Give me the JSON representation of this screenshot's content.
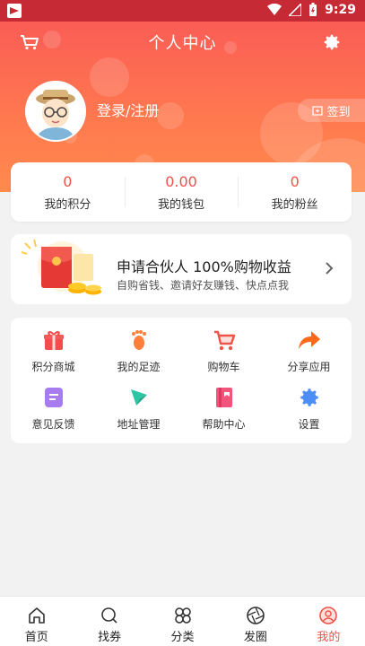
{
  "status_bar": {
    "time": "9:29"
  },
  "header": {
    "title": "个人中心"
  },
  "profile": {
    "login_label": "登录/注册",
    "checkin_label": "签到"
  },
  "stats": [
    {
      "value": "0",
      "label": "我的积分"
    },
    {
      "value": "0.00",
      "label": "我的钱包"
    },
    {
      "value": "0",
      "label": "我的粉丝"
    }
  ],
  "promo": {
    "title": "申请合伙人 100%购物收益",
    "subtitle": "自购省钱、邀请好友赚钱、快点点我"
  },
  "menu": [
    {
      "label": "积分商城",
      "icon": "gift-icon",
      "color": "#f44b4b"
    },
    {
      "label": "我的足迹",
      "icon": "footprint-icon",
      "color": "#ff7e3a"
    },
    {
      "label": "购物车",
      "icon": "cart-icon",
      "color": "#f0534a"
    },
    {
      "label": "分享应用",
      "icon": "share-icon",
      "color": "#ff6a1a"
    },
    {
      "label": "意见反馈",
      "icon": "feedback-icon",
      "color": "#a77cf0"
    },
    {
      "label": "地址管理",
      "icon": "compass-icon",
      "color": "#2cc6a5"
    },
    {
      "label": "帮助中心",
      "icon": "help-book-icon",
      "color": "#f2557b"
    },
    {
      "label": "设置",
      "icon": "gear-icon",
      "color": "#4c8ef5"
    }
  ],
  "tabs": [
    {
      "label": "首页",
      "icon": "home-icon",
      "active": false
    },
    {
      "label": "找券",
      "icon": "search-icon",
      "active": false
    },
    {
      "label": "分类",
      "icon": "category-icon",
      "active": false
    },
    {
      "label": "发圈",
      "icon": "aperture-icon",
      "active": false
    },
    {
      "label": "我的",
      "icon": "profile-icon",
      "active": true
    }
  ],
  "colors": {
    "accent": "#f0534a",
    "header_top": "#fa5d55",
    "header_bottom": "#ff8a4d"
  }
}
